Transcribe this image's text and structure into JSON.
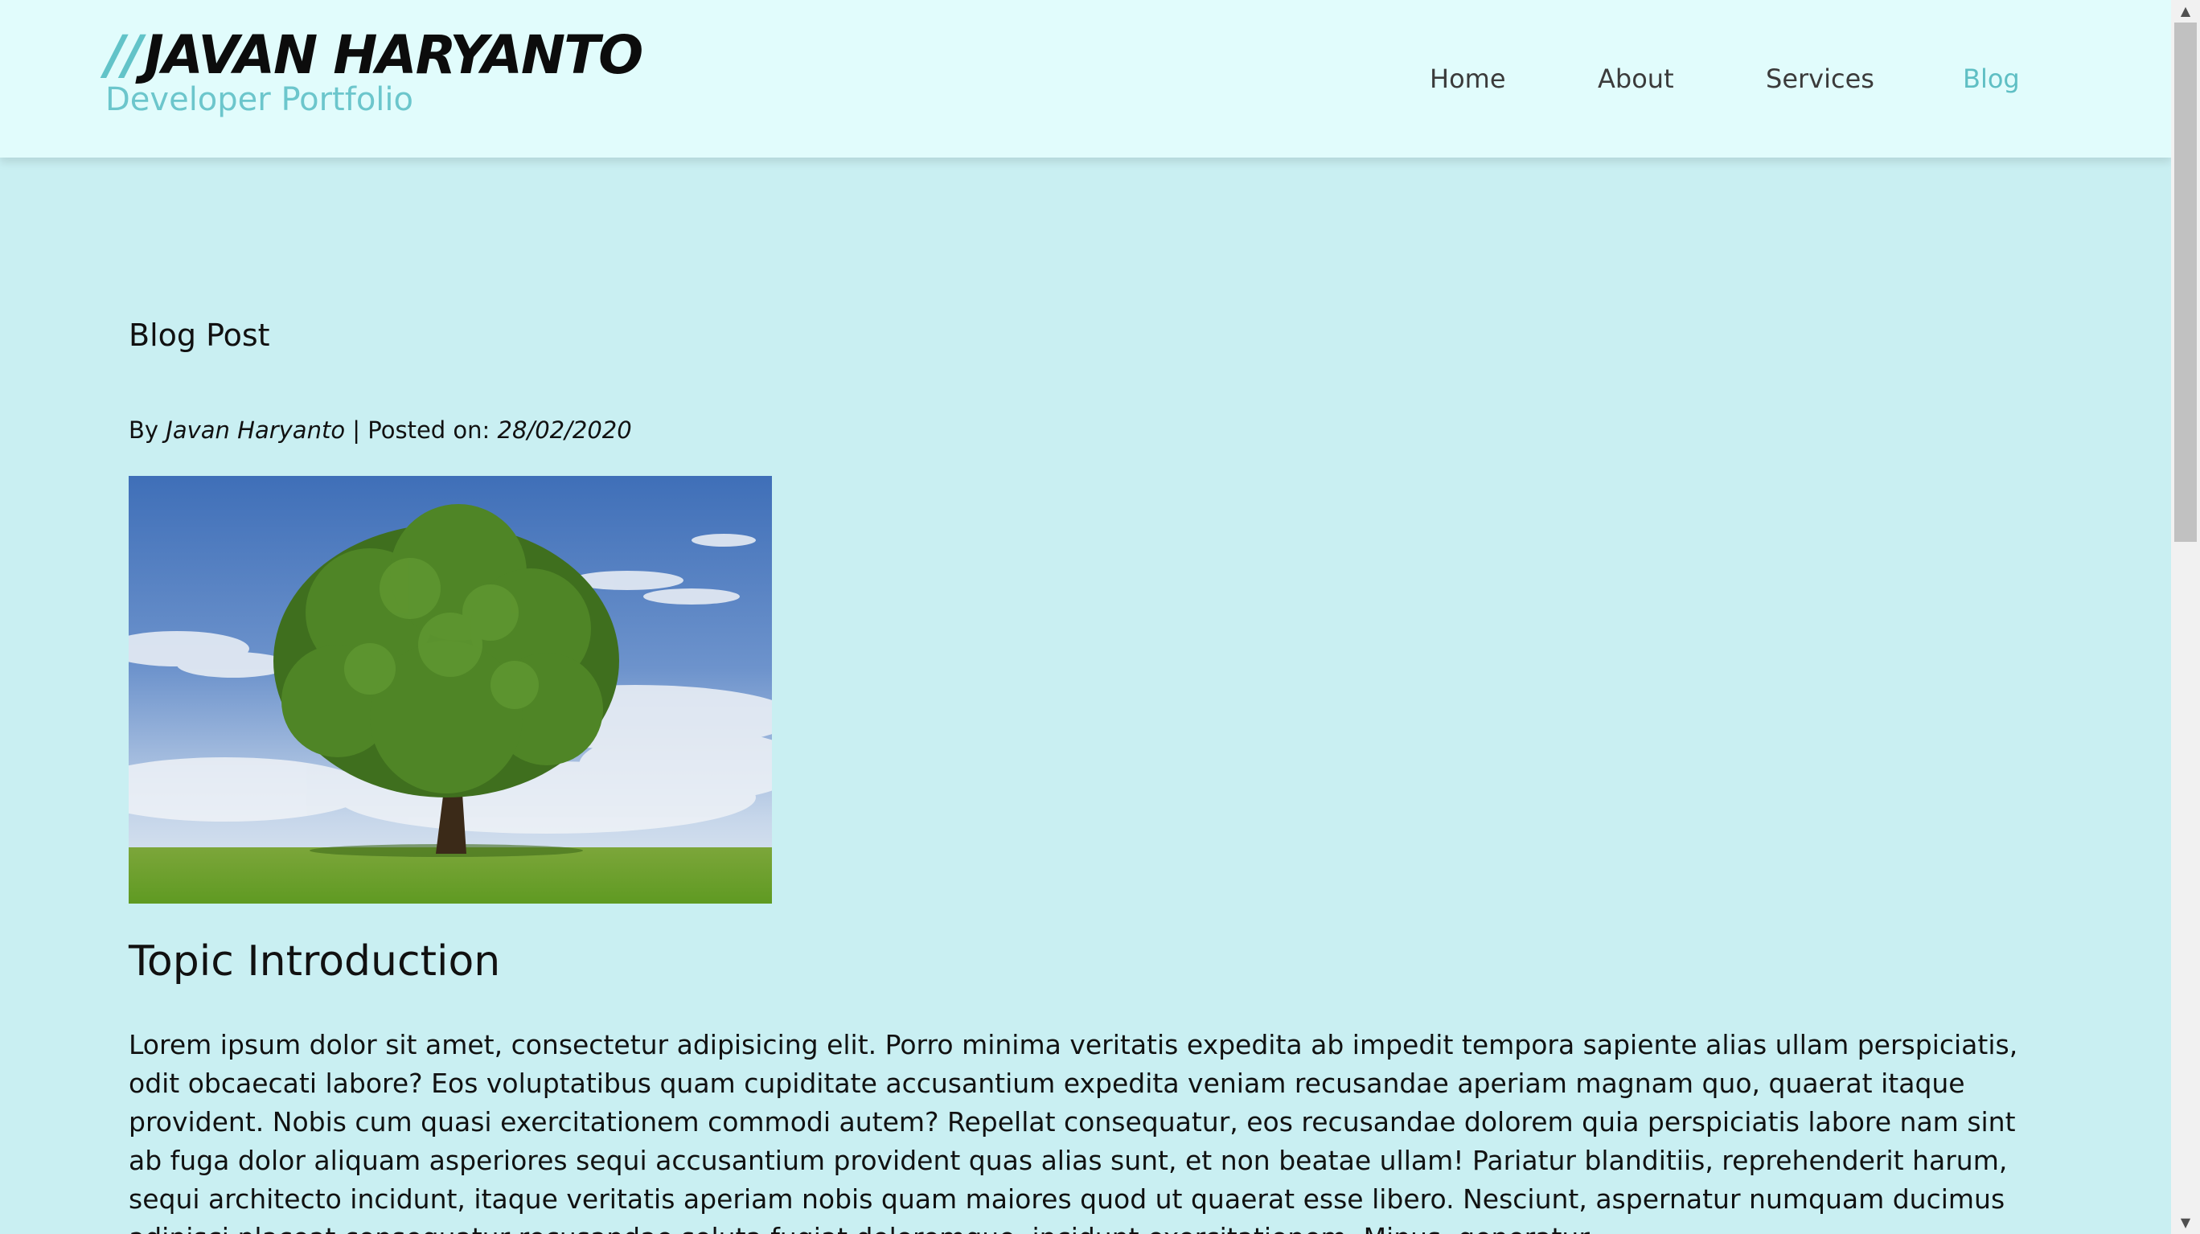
{
  "brand": {
    "slashes": "//",
    "name": "JAVAN HARYANTO",
    "subtitle": "Developer Portfolio"
  },
  "nav": {
    "items": [
      {
        "label": "Home",
        "active": false
      },
      {
        "label": "About",
        "active": false
      },
      {
        "label": "Services",
        "active": false
      },
      {
        "label": "Blog",
        "active": true
      }
    ]
  },
  "post": {
    "title": "Blog Post",
    "by_label": "By",
    "author": "Javan Haryanto",
    "separator": "| Posted on:",
    "date": "28/02/2020",
    "section_title": "Topic Introduction",
    "paragraph": "Lorem ipsum dolor sit amet, consectetur adipisicing elit. Porro minima veritatis expedita ab impedit tempora sapiente alias ullam perspiciatis, odit obcaecati labore? Eos voluptatibus quam cupiditate accusantium expedita veniam recusandae aperiam magnam quo, quaerat itaque provident. Nobis cum quasi exercitationem commodi autem? Repellat consequatur, eos recusandae dolorem quia perspiciatis labore nam sint ab fuga dolor aliquam asperiores sequi accusantium provident quas alias sunt, et non beatae ullam! Pariatur blanditiis, reprehenderit harum, sequi architecto incidunt, itaque veritatis aperiam nobis quam maiores quod ut quaerat esse libero. Nesciunt, aspernatur numquam ducimus adipisci placeat consequatur recusandae soluta fugiat doloremque, incidunt exercitationem. Minus, generatur"
  },
  "colors": {
    "page_bg": "#c9eff2",
    "header_bg": "#e1fcfc",
    "accent": "#5fbfc4",
    "text": "#111111",
    "nav_text": "#3b3b3b"
  },
  "icons": {
    "hero_image": "tree-in-field-image",
    "scroll_up": "chevron-up-icon",
    "scroll_down": "chevron-down-icon"
  }
}
